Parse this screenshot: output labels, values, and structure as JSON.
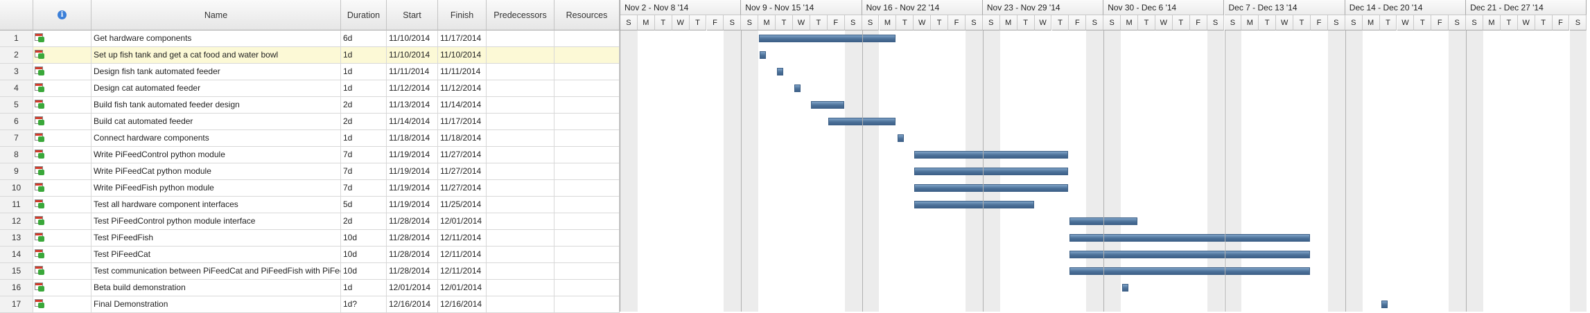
{
  "columns": {
    "indicators_icon": "info-icon",
    "name": "Name",
    "duration": "Duration",
    "start": "Start",
    "finish": "Finish",
    "predecessors": "Predecessors",
    "resources": "Resources"
  },
  "selected_row": 2,
  "tasks": [
    {
      "id": "1",
      "name": "Get hardware components",
      "duration": "6d",
      "start": "11/10/2014",
      "finish": "11/17/2014"
    },
    {
      "id": "2",
      "name": "Set up fish tank and get a cat food and water bowl",
      "duration": "1d",
      "start": "11/10/2014",
      "finish": "11/10/2014"
    },
    {
      "id": "3",
      "name": "Design fish tank automated feeder",
      "duration": "1d",
      "start": "11/11/2014",
      "finish": "11/11/2014"
    },
    {
      "id": "4",
      "name": "Design cat automated feeder",
      "duration": "1d",
      "start": "11/12/2014",
      "finish": "11/12/2014"
    },
    {
      "id": "5",
      "name": "Build fish tank automated feeder design",
      "duration": "2d",
      "start": "11/13/2014",
      "finish": "11/14/2014"
    },
    {
      "id": "6",
      "name": "Build cat automated feeder",
      "duration": "2d",
      "start": "11/14/2014",
      "finish": "11/17/2014"
    },
    {
      "id": "7",
      "name": "Connect hardware components",
      "duration": "1d",
      "start": "11/18/2014",
      "finish": "11/18/2014"
    },
    {
      "id": "8",
      "name": "Write PiFeedControl python module",
      "duration": "7d",
      "start": "11/19/2014",
      "finish": "11/27/2014"
    },
    {
      "id": "9",
      "name": "Write PiFeedCat python module",
      "duration": "7d",
      "start": "11/19/2014",
      "finish": "11/27/2014"
    },
    {
      "id": "10",
      "name": "Write PiFeedFish python module",
      "duration": "7d",
      "start": "11/19/2014",
      "finish": "11/27/2014"
    },
    {
      "id": "11",
      "name": "Test all hardware component interfaces",
      "duration": "5d",
      "start": "11/19/2014",
      "finish": "11/25/2014"
    },
    {
      "id": "12",
      "name": "Test PiFeedControl python module interface",
      "duration": "2d",
      "start": "11/28/2014",
      "finish": "12/01/2014"
    },
    {
      "id": "13",
      "name": "Test PiFeedFish",
      "duration": "10d",
      "start": "11/28/2014",
      "finish": "12/11/2014"
    },
    {
      "id": "14",
      "name": "Test PiFeedCat",
      "duration": "10d",
      "start": "11/28/2014",
      "finish": "12/11/2014"
    },
    {
      "id": "15",
      "name": "Test communication between PiFeedCat and PiFeedFish with PiFeedControl",
      "duration": "10d",
      "start": "11/28/2014",
      "finish": "12/11/2014"
    },
    {
      "id": "16",
      "name": "Beta build demonstration",
      "duration": "1d",
      "start": "12/01/2014",
      "finish": "12/01/2014"
    },
    {
      "id": "17",
      "name": "Final Demonstration",
      "duration": "1d?",
      "start": "12/16/2014",
      "finish": "12/16/2014"
    }
  ],
  "timeline": {
    "weeks": [
      "Nov 2 - Nov 8 '14",
      "Nov 9 - Nov 15 '14",
      "Nov 16 - Nov 22 '14",
      "Nov 23 - Nov 29 '14",
      "Nov 30 - Dec 6 '14",
      "Dec 7 - Dec 13 '14",
      "Dec 14 - Dec 20 '14",
      "Dec 21 - Dec 27 '14"
    ],
    "day_letters": [
      "S",
      "M",
      "T",
      "W",
      "T",
      "F",
      "S"
    ]
  },
  "colors": {
    "bar": "#4c7199",
    "weekend": "#ececec",
    "selected_row": "#fcf9d6"
  }
}
